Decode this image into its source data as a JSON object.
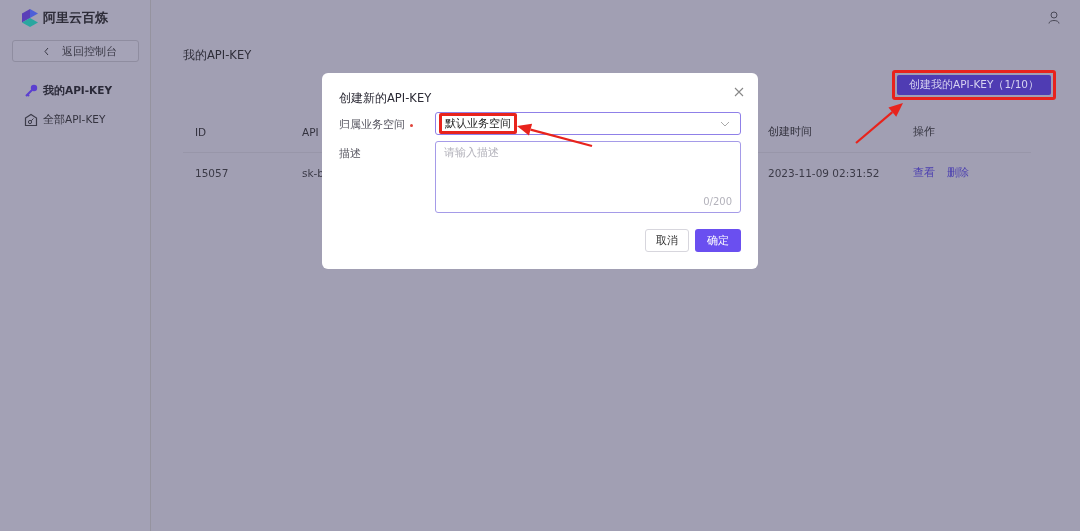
{
  "app": {
    "name": "阿里云百炼"
  },
  "sidebar": {
    "back_button": "返回控制台",
    "items": [
      {
        "label": "我的API-KEY",
        "selected": true
      },
      {
        "label": "全部API-KEY",
        "selected": false
      }
    ]
  },
  "page": {
    "title": "我的API-KEY",
    "create_button": {
      "label": "创建我的API-KEY（1/10）",
      "highlighted": true
    }
  },
  "table": {
    "columns": [
      "ID",
      "API",
      "创建时间",
      "操作"
    ],
    "rows": [
      {
        "cells": [
          "15057",
          "sk-b",
          "2023-11-09 02:31:52"
        ],
        "actions": [
          "查看",
          "删除"
        ]
      }
    ]
  },
  "dialog": {
    "title": "创建新的API-KEY",
    "fields": [
      {
        "kind": "select",
        "label": "归属业务空间",
        "required": true,
        "value": "默认业务空间",
        "highlighted": true
      },
      {
        "kind": "textarea",
        "label": "描述",
        "required": false,
        "placeholder": "请输入描述",
        "counter": "0/200"
      }
    ],
    "buttons": [
      {
        "label": "取消",
        "kind": "secondary"
      },
      {
        "label": "确定",
        "kind": "primary"
      }
    ]
  }
}
